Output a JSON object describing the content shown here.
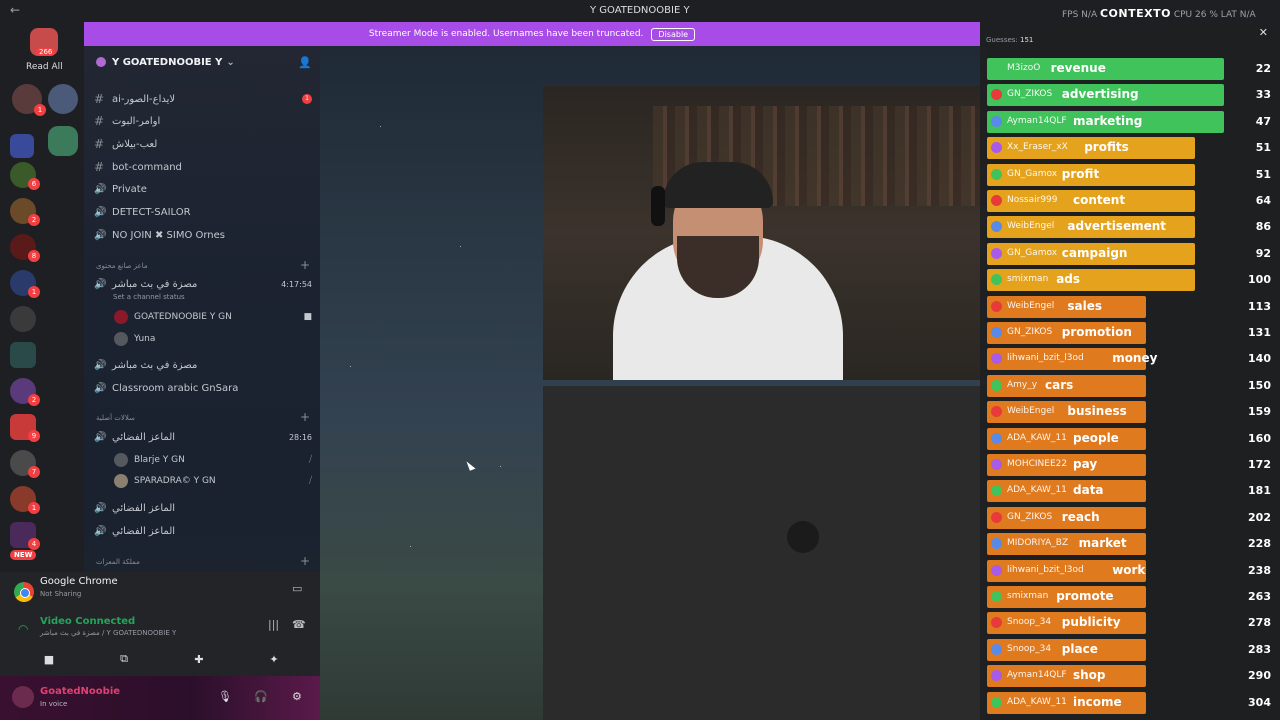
{
  "titlebar": {
    "title": "Y GOATEDNOOBIE Y",
    "fps": "FPS N/A",
    "context": "CONTEXTO",
    "cpu": "CPU 26 %",
    "lat": "LAT N/A"
  },
  "server_rail": {
    "dm_badge": "266",
    "read_all": "Read All",
    "new_label": "NEW"
  },
  "server": {
    "name": "Y GOATEDNOOBIE Y"
  },
  "channels": [
    {
      "type": "text",
      "name": "ai-لايداع-الصور",
      "unread": "1"
    },
    {
      "type": "text",
      "name": "اوامر-البوت"
    },
    {
      "type": "text",
      "name": "لعب-بيلاش"
    },
    {
      "type": "text",
      "name": "bot-command"
    },
    {
      "type": "voice",
      "name": "Private"
    },
    {
      "type": "voice",
      "name": "DETECT-SAILOR"
    },
    {
      "type": "voice",
      "name": "NO JOIN ✖ SIMO Ornes"
    }
  ],
  "category1": {
    "name": "ماعز صانع محتوى"
  },
  "active_voice": {
    "name": "مصزة في بث مباشر",
    "time": "4:17:54",
    "status": "Set a channel status"
  },
  "voice_members1": [
    "GOATEDNOOBIE Y GN",
    "Yuna"
  ],
  "channels2": [
    {
      "type": "voice",
      "name": "مصزة في بث مباشر"
    },
    {
      "type": "voice",
      "name": "Classroom arabic GnSara"
    }
  ],
  "category2": {
    "name": "سلالات أصلية"
  },
  "voice2": {
    "name": "الماعز الفضائي",
    "time": "28:16"
  },
  "voice_members2": [
    "Blarje Y GN",
    "SPARADRA© Y GN"
  ],
  "channels3": [
    {
      "type": "voice",
      "name": "الماعز الفضائي"
    },
    {
      "type": "voice",
      "name": "الماعز الفضائي"
    }
  ],
  "category3": {
    "name": "مملكة المعزات"
  },
  "activity": {
    "app": "Google Chrome",
    "sub": "Not Sharing"
  },
  "voice_conn": {
    "title": "Video Connected",
    "sub": "مصزة في بث مباشر / Y GOATEDNOOBIE Y"
  },
  "user": {
    "name": "GoatedNoobie",
    "status": "In voice"
  },
  "banner": {
    "text": "Streamer Mode is enabled. Usernames have been truncated.",
    "button": "Disable"
  },
  "overlay": {
    "guesses_label": "Guesses:",
    "guesses_count": "151",
    "rows": [
      {
        "user": "M3izoO",
        "word": "revenue",
        "rank": "22",
        "color": "#3fc35a"
      },
      {
        "user": "GN_ZIKOS",
        "word": "advertising",
        "rank": "33",
        "color": "#3fc35a"
      },
      {
        "user": "Ayman14QLF",
        "word": "marketing",
        "rank": "47",
        "color": "#3fc35a"
      },
      {
        "user": "Xx_Eraser_xX",
        "word": "profits",
        "rank": "51",
        "color": "#e5a21d"
      },
      {
        "user": "GN_Gamox",
        "word": "profit",
        "rank": "51",
        "color": "#e5a21d"
      },
      {
        "user": "Nossair999",
        "word": "content",
        "rank": "64",
        "color": "#e5a21d"
      },
      {
        "user": "WeibEngel",
        "word": "advertisement",
        "rank": "86",
        "color": "#e5a21d"
      },
      {
        "user": "GN_Gamox",
        "word": "campaign",
        "rank": "92",
        "color": "#e5a21d"
      },
      {
        "user": "smixman",
        "word": "ads",
        "rank": "100",
        "color": "#e5a21d"
      },
      {
        "user": "WeibEngel",
        "word": "sales",
        "rank": "113",
        "color": "#e07a1f"
      },
      {
        "user": "GN_ZIKOS",
        "word": "promotion",
        "rank": "131",
        "color": "#e07a1f"
      },
      {
        "user": "lihwani_bzit_l3od",
        "word": "money",
        "rank": "140",
        "color": "#e07a1f"
      },
      {
        "user": "Amy_y",
        "word": "cars",
        "rank": "150",
        "color": "#e07a1f"
      },
      {
        "user": "WeibEngel",
        "word": "business",
        "rank": "159",
        "color": "#e07a1f"
      },
      {
        "user": "ADA_KAW_11",
        "word": "people",
        "rank": "160",
        "color": "#e07a1f"
      },
      {
        "user": "MOHCINEE22",
        "word": "pay",
        "rank": "172",
        "color": "#e07a1f"
      },
      {
        "user": "ADA_KAW_11",
        "word": "data",
        "rank": "181",
        "color": "#e07a1f"
      },
      {
        "user": "GN_ZIKOS",
        "word": "reach",
        "rank": "202",
        "color": "#e07a1f"
      },
      {
        "user": "MIDORIYA_BZ",
        "word": "market",
        "rank": "228",
        "color": "#e07a1f"
      },
      {
        "user": "lihwani_bzit_l3od",
        "word": "work",
        "rank": "238",
        "color": "#e07a1f"
      },
      {
        "user": "smixman",
        "word": "promote",
        "rank": "263",
        "color": "#e07a1f"
      },
      {
        "user": "Snoop_34",
        "word": "publicity",
        "rank": "278",
        "color": "#e07a1f"
      },
      {
        "user": "Snoop_34",
        "word": "place",
        "rank": "283",
        "color": "#e07a1f"
      },
      {
        "user": "Ayman14QLF",
        "word": "shop",
        "rank": "290",
        "color": "#e07a1f"
      },
      {
        "user": "ADA_KAW_11",
        "word": "income",
        "rank": "304",
        "color": "#e07a1f"
      }
    ]
  }
}
